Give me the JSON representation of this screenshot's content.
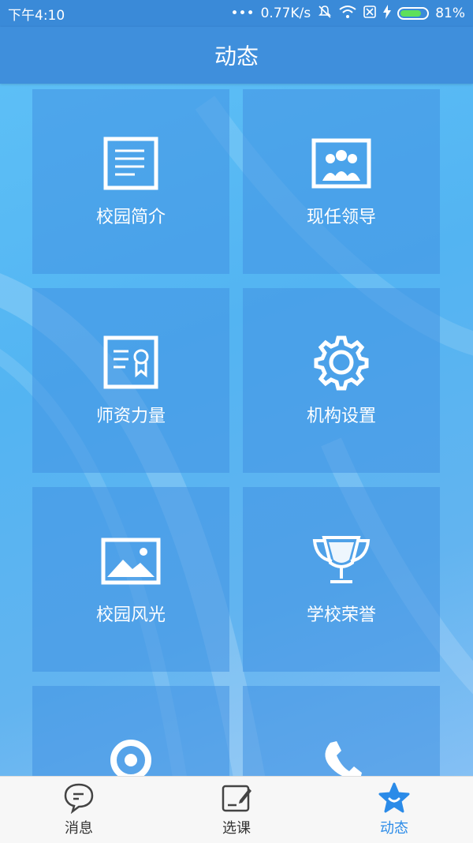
{
  "status": {
    "time": "下午4:10",
    "dots": "•••",
    "speed": "0.77K/s",
    "battery": "81%",
    "battery_level": 0.81
  },
  "header": {
    "title": "动态"
  },
  "tiles": [
    {
      "label": "校园简介",
      "icon": "document-icon"
    },
    {
      "label": "现任领导",
      "icon": "leaders-icon"
    },
    {
      "label": "师资力量",
      "icon": "certificate-icon"
    },
    {
      "label": "机构设置",
      "icon": "gear-icon"
    },
    {
      "label": "校园风光",
      "icon": "landscape-image-icon"
    },
    {
      "label": "学校荣誉",
      "icon": "trophy-icon"
    },
    {
      "label": "",
      "icon": "location-pin-icon"
    },
    {
      "label": "",
      "icon": "phone-icon"
    }
  ],
  "tabbar": {
    "items": [
      {
        "label": "消息",
        "icon": "chat-bubble-icon",
        "active": false
      },
      {
        "label": "选课",
        "icon": "edit-note-icon",
        "active": false
      },
      {
        "label": "动态",
        "icon": "star-icon",
        "active": true
      }
    ]
  },
  "colors": {
    "accent": "#2b8be8",
    "header": "#3f8fdc",
    "battery_fill": "#5ee05a"
  }
}
